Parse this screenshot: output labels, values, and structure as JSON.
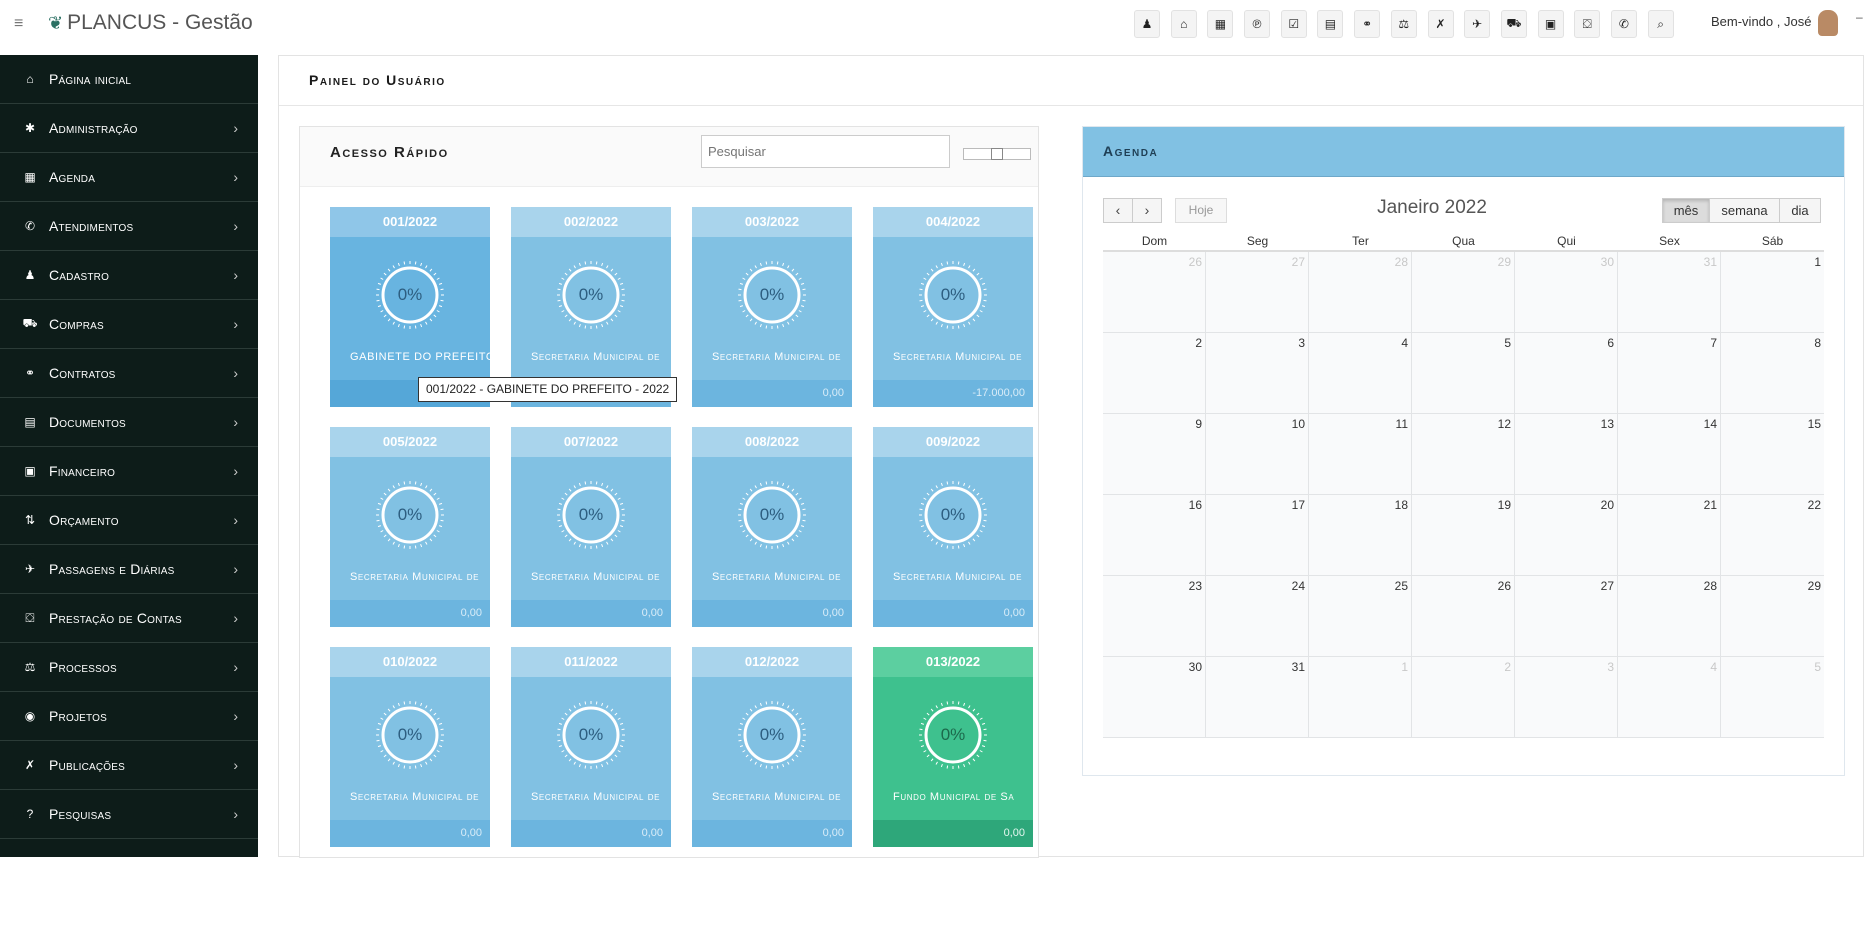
{
  "app": {
    "title": "PLANCUS - Gestão"
  },
  "topbar": {
    "icons": [
      "person-icon",
      "bank-icon",
      "calendar-icon",
      "pinterest-icon",
      "checkbox-icon",
      "document-icon",
      "handshake-icon",
      "scale-icon",
      "xing-icon",
      "plane-icon",
      "truck-icon",
      "money-icon",
      "stamp-icon",
      "phone-icon",
      "search-icon"
    ],
    "welcome": "Bem-vindo , José"
  },
  "sidebar": {
    "items": [
      {
        "label": "Página inicial",
        "icon": "home-icon",
        "glyph": "⌂",
        "chevron": false
      },
      {
        "label": "Administração",
        "icon": "gear-icon",
        "glyph": "✱",
        "chevron": true
      },
      {
        "label": "Agenda",
        "icon": "calendar-icon",
        "glyph": "▦",
        "chevron": true
      },
      {
        "label": "Atendimentos",
        "icon": "phone-icon",
        "glyph": "✆",
        "chevron": true
      },
      {
        "label": "Cadastro",
        "icon": "person-icon",
        "glyph": "♟",
        "chevron": true
      },
      {
        "label": "Compras",
        "icon": "truck-icon",
        "glyph": "⛟",
        "chevron": true
      },
      {
        "label": "Contratos",
        "icon": "handshake-icon",
        "glyph": "⚭",
        "chevron": true
      },
      {
        "label": "Documentos",
        "icon": "document-icon",
        "glyph": "▤",
        "chevron": true
      },
      {
        "label": "Financeiro",
        "icon": "money-icon",
        "glyph": "▣",
        "chevron": true
      },
      {
        "label": "Orçamento",
        "icon": "sort-icon",
        "glyph": "⇅",
        "chevron": true
      },
      {
        "label": "Passagens e Diárias",
        "icon": "plane-icon",
        "glyph": "✈",
        "chevron": true
      },
      {
        "label": "Prestação de Contas",
        "icon": "stamp-icon",
        "glyph": "⛋",
        "chevron": true
      },
      {
        "label": "Processos",
        "icon": "scale-icon",
        "glyph": "⚖",
        "chevron": true
      },
      {
        "label": "Projetos",
        "icon": "globe-icon",
        "glyph": "◉",
        "chevron": true
      },
      {
        "label": "Publicações",
        "icon": "xing-icon",
        "glyph": "✗",
        "chevron": true
      },
      {
        "label": "Pesquisas",
        "icon": "question-icon",
        "glyph": "?",
        "chevron": true
      }
    ]
  },
  "page": {
    "title": "Painel do Usuário"
  },
  "quick_access": {
    "title": "Acesso Rápido",
    "search_placeholder": "Pesquisar",
    "cards": [
      {
        "code": "001/2022",
        "percent": "0%",
        "name": "GABINETE DO PREFEITO",
        "value": "",
        "style": "dark"
      },
      {
        "code": "002/2022",
        "percent": "0%",
        "name": "Secretaria Municipal de",
        "value": "",
        "style": "light"
      },
      {
        "code": "003/2022",
        "percent": "0%",
        "name": "Secretaria Municipal de",
        "value": "0,00",
        "style": "light"
      },
      {
        "code": "004/2022",
        "percent": "0%",
        "name": "Secretaria Municipal de",
        "value": "-17.000,00",
        "style": "light"
      },
      {
        "code": "005/2022",
        "percent": "0%",
        "name": "Secretaria Municipal de",
        "value": "0,00",
        "style": "light"
      },
      {
        "code": "007/2022",
        "percent": "0%",
        "name": "Secretaria Municipal de",
        "value": "0,00",
        "style": "light"
      },
      {
        "code": "008/2022",
        "percent": "0%",
        "name": "Secretaria Municipal de",
        "value": "0,00",
        "style": "light"
      },
      {
        "code": "009/2022",
        "percent": "0%",
        "name": "Secretaria Municipal de",
        "value": "0,00",
        "style": "light"
      },
      {
        "code": "010/2022",
        "percent": "0%",
        "name": "Secretaria Municipal de",
        "value": "0,00",
        "style": "light"
      },
      {
        "code": "011/2022",
        "percent": "0%",
        "name": "Secretaria Municipal de",
        "value": "0,00",
        "style": "light"
      },
      {
        "code": "012/2022",
        "percent": "0%",
        "name": "Secretaria Municipal de",
        "value": "0,00",
        "style": "light"
      },
      {
        "code": "013/2022",
        "percent": "0%",
        "name": "Fundo Municipal de Sa",
        "value": "0,00",
        "style": "green"
      }
    ],
    "tooltip": "001/2022 - GABINETE DO PREFEITO - 2022"
  },
  "agenda": {
    "title": "Agenda",
    "prev": "‹",
    "next": "›",
    "today": "Hoje",
    "month": "Janeiro 2022",
    "views": [
      "mês",
      "semana",
      "dia"
    ],
    "active_view": "mês",
    "weekdays": [
      "Dom",
      "Seg",
      "Ter",
      "Qua",
      "Qui",
      "Sex",
      "Sáb"
    ],
    "weeks": [
      [
        {
          "d": "26",
          "o": true
        },
        {
          "d": "27",
          "o": true
        },
        {
          "d": "28",
          "o": true
        },
        {
          "d": "29",
          "o": true
        },
        {
          "d": "30",
          "o": true
        },
        {
          "d": "31",
          "o": true
        },
        {
          "d": "1",
          "o": false
        }
      ],
      [
        {
          "d": "2",
          "o": false
        },
        {
          "d": "3",
          "o": false
        },
        {
          "d": "4",
          "o": false
        },
        {
          "d": "5",
          "o": false
        },
        {
          "d": "6",
          "o": false
        },
        {
          "d": "7",
          "o": false
        },
        {
          "d": "8",
          "o": false
        }
      ],
      [
        {
          "d": "9",
          "o": false
        },
        {
          "d": "10",
          "o": false
        },
        {
          "d": "11",
          "o": false
        },
        {
          "d": "12",
          "o": false
        },
        {
          "d": "13",
          "o": false
        },
        {
          "d": "14",
          "o": false
        },
        {
          "d": "15",
          "o": false
        }
      ],
      [
        {
          "d": "16",
          "o": false
        },
        {
          "d": "17",
          "o": false
        },
        {
          "d": "18",
          "o": false
        },
        {
          "d": "19",
          "o": false
        },
        {
          "d": "20",
          "o": false
        },
        {
          "d": "21",
          "o": false
        },
        {
          "d": "22",
          "o": false
        }
      ],
      [
        {
          "d": "23",
          "o": false
        },
        {
          "d": "24",
          "o": false
        },
        {
          "d": "25",
          "o": false
        },
        {
          "d": "26",
          "o": false
        },
        {
          "d": "27",
          "o": false
        },
        {
          "d": "28",
          "o": false
        },
        {
          "d": "29",
          "o": false
        }
      ],
      [
        {
          "d": "30",
          "o": false
        },
        {
          "d": "31",
          "o": false
        },
        {
          "d": "1",
          "o": true
        },
        {
          "d": "2",
          "o": true
        },
        {
          "d": "3",
          "o": true
        },
        {
          "d": "4",
          "o": true
        },
        {
          "d": "5",
          "o": true
        }
      ]
    ]
  }
}
